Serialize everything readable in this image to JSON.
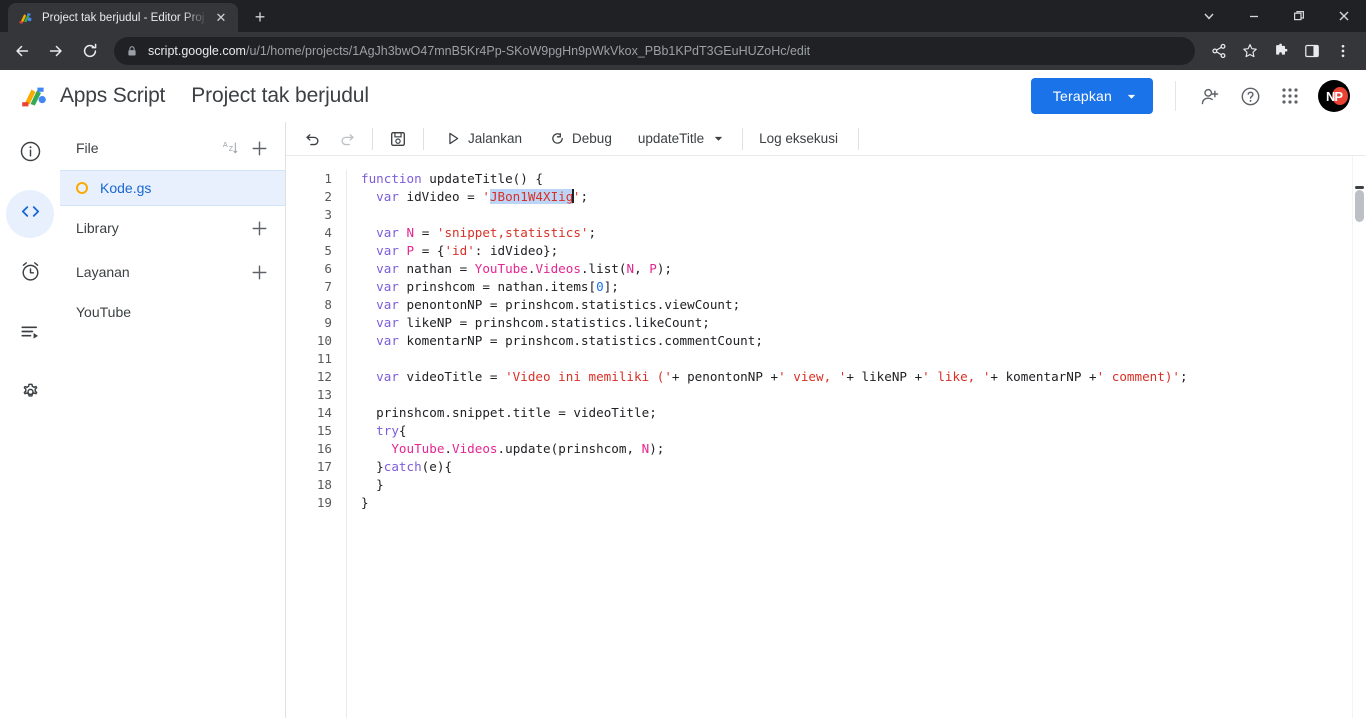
{
  "browser": {
    "tab": {
      "title": "Project tak berjudul - Editor Proj",
      "favicon_name": "apps-script-favicon",
      "close_label": "✕",
      "new_tab_label": "+"
    },
    "window_controls": {
      "list_tabs": "⌄",
      "minimize": "–",
      "maximize": "❐",
      "close": "✕"
    },
    "nav": {
      "back": "←",
      "forward": "→",
      "reload": "⟳"
    },
    "omnibox": {
      "lock_icon": "lock-icon",
      "url_domain": "script.google.com",
      "url_path": "/u/1/home/projects/1AgJh3bwO47mnB5Kr4Pp-SKoW9pgHn9pWkVkox_PBb1KPdT3GEuHUZoHc/edit"
    },
    "toolbar_icons": [
      "share-icon",
      "bookmark-star-icon",
      "extensions-puzzle-icon",
      "side-panel-icon",
      "chrome-menu-icon"
    ]
  },
  "app_header": {
    "logo_text": "Apps Script",
    "project_title": "Project tak berjudul",
    "deploy_button": "Terapkan",
    "deploy_caret": "▾",
    "icons": [
      "add-people-icon",
      "help-icon",
      "google-apps-grid-icon"
    ],
    "avatar_initials": "NP",
    "accent_color": "#1a73e8"
  },
  "rail": {
    "items": [
      {
        "name": "overview",
        "icon": "info-circle-icon",
        "active": false
      },
      {
        "name": "editor",
        "icon": "code-brackets-icon",
        "active": true
      },
      {
        "name": "triggers",
        "icon": "alarm-clock-icon",
        "active": false
      },
      {
        "name": "executions",
        "icon": "executions-list-icon",
        "active": false
      },
      {
        "name": "settings",
        "icon": "gear-icon",
        "active": false
      }
    ]
  },
  "file_panel": {
    "file_header": "File",
    "sort_icon": "sort-az-icon",
    "add_icon": "plus-icon",
    "files": [
      {
        "name": "Kode.gs",
        "selected": true
      }
    ],
    "library_header": "Library",
    "libraries": [],
    "services_header": "Layanan",
    "services": [
      {
        "name": "YouTube"
      }
    ]
  },
  "editor_toolbar": {
    "undo": "undo-icon",
    "redo": "redo-icon",
    "save": "save-icon",
    "run_label": "Jalankan",
    "run_icon": "play-triangle-icon",
    "debug_label": "Debug",
    "debug_icon": "debug-bug-icon",
    "function_selected": "updateTitle",
    "function_caret": "▾",
    "execution_log_label": "Log eksekusi"
  },
  "code": {
    "selected_text": "JBon1W4XIig",
    "line_numbers": [
      1,
      2,
      3,
      4,
      5,
      6,
      7,
      8,
      9,
      10,
      11,
      12,
      13,
      14,
      15,
      16,
      17,
      18,
      19
    ],
    "lines": [
      "function updateTitle() {",
      "  var idVideo = 'JBon1W4XIig';",
      "",
      "  var N = 'snippet,statistics';",
      "  var P = {'id': idVideo};",
      "  var nathan = YouTube.Videos.list(N, P);",
      "  var prinshcom = nathan.items[0];",
      "  var penontonNP = prinshcom.statistics.viewCount;",
      "  var likeNP = prinshcom.statistics.likeCount;",
      "  var komentarNP = prinshcom.statistics.commentCount;",
      "",
      "  var videoTitle = 'Video ini memiliki ('+ penontonNP +' view, '+ likeNP +' like, '+ komentarNP +' comment)';",
      "",
      "  prinshcom.snippet.title = videoTitle;",
      "  try{",
      "    YouTube.Videos.update(prinshcom, N);",
      "  }catch(e){",
      "  }",
      "}"
    ],
    "syntax_colors": {
      "keyword": "#7b5ddb",
      "string": "#d93025",
      "number": "#1a73e8",
      "class": "#e52592",
      "identifier": "#202124",
      "selection": "#bcd5f7"
    }
  }
}
